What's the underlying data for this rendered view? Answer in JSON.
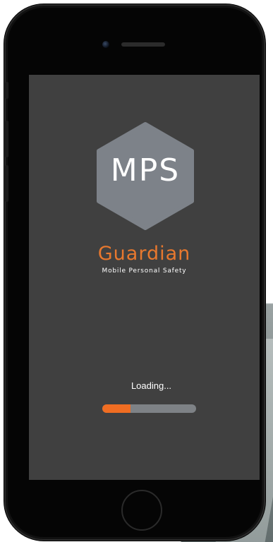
{
  "app": {
    "logo": {
      "text": "MPS",
      "color": "#7d8289",
      "text_color": "#ffffff",
      "icon": "hexagon-logo-icon"
    },
    "brand_title": "Guardian",
    "brand_subtitle": "Mobile Personal Safety",
    "brand_color": "#e8782e",
    "loading": {
      "label": "Loading...",
      "progress": 0.3,
      "fill_color": "#f06d22",
      "track_color": "#7e8286"
    }
  },
  "device": {
    "screen_color": "#404040",
    "body_color": "#050505",
    "home_button_icon": "home-button-icon"
  }
}
